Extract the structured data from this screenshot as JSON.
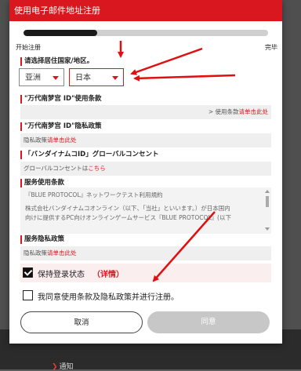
{
  "title": "使用电子邮件地址注册",
  "progress": {
    "value": 0.3,
    "start_label": "开始注册",
    "end_label": "完毕"
  },
  "region": {
    "label": "请选择居住国家/地区。",
    "region_select": "亚洲",
    "country_select": "日本"
  },
  "terms": {
    "label": "\"万代南梦宫 ID\"使用条款",
    "text_prefix": "> 使用条款",
    "link": "请单击此处"
  },
  "privacy": {
    "label": "\"万代南梦宫 ID\"隐私政策",
    "text_prefix": "隐私政策",
    "link": "请单击此处"
  },
  "global_consent": {
    "label": "「バンダイナムコID」グローバルコンセント",
    "text_prefix": "グローバルコンセントは",
    "link": "こちら"
  },
  "service_terms": {
    "label": "服务使用条款",
    "line1": "『BLUE PROTOCOL』ネットワークテスト利用規約",
    "line2": "株式会社バンダイナムコオンライン（以下、「当社」といいます。）が日本国内",
    "line3": "向けに提供するPC向けオンラインゲームサービス『BLUE PROTOCOL』(以下"
  },
  "service_privacy": {
    "label": "服务隐私政策",
    "text_prefix": "隐私政策",
    "link": "请单击此处"
  },
  "keep_login": {
    "label": "保持登录状态",
    "detail": "（详情）",
    "checked": true
  },
  "agree_terms": {
    "label": "我同意使用条款及隐私政策并进行注册。",
    "checked": false
  },
  "buttons": {
    "cancel": "取消",
    "agree": "同意"
  },
  "footer": {
    "link": "通知"
  },
  "colors": {
    "accent": "#d8181e",
    "disabled": "#c7c7c7"
  }
}
